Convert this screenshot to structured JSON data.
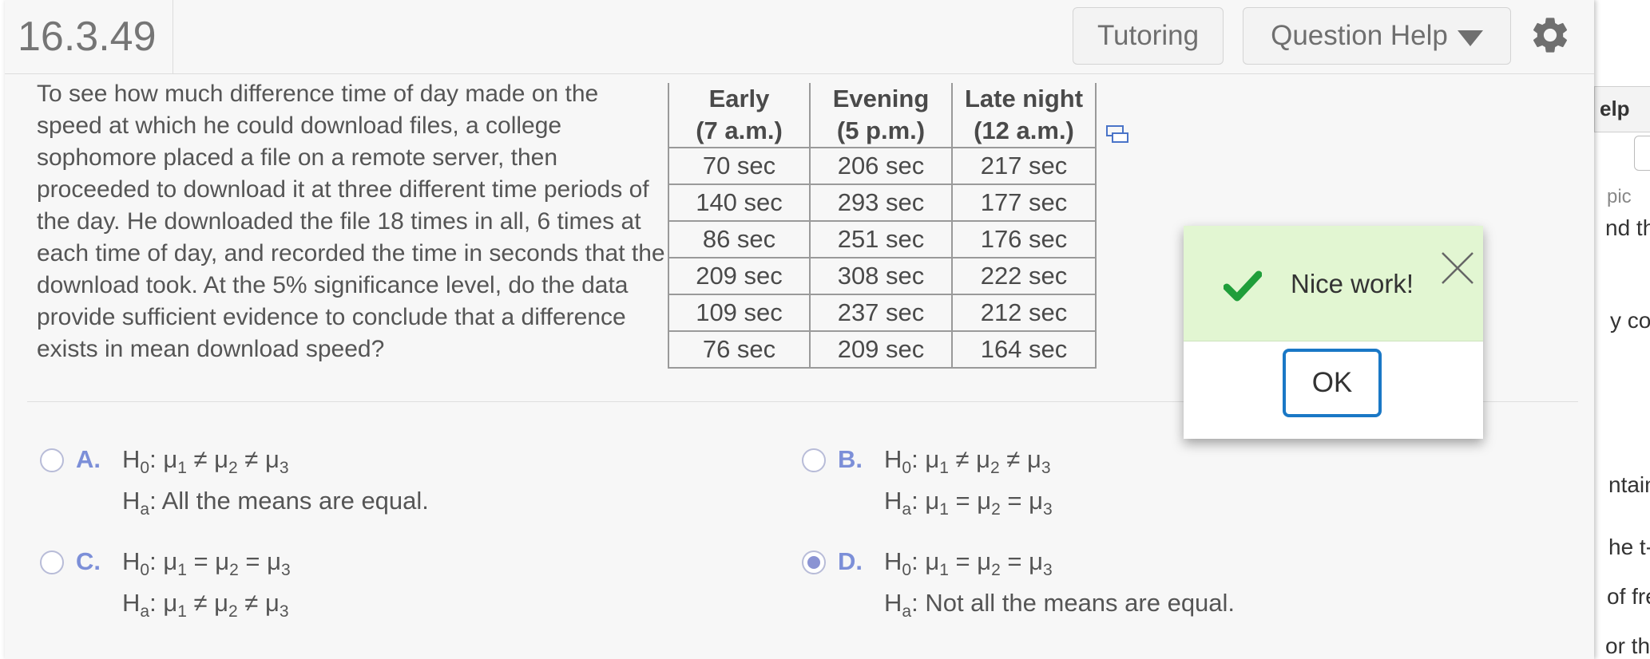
{
  "background_window": {
    "tab_label": "elp",
    "fragments": [
      "pic",
      "nd the",
      "y cor",
      "ntaini",
      "he t-s",
      "of free",
      "or the"
    ]
  },
  "header": {
    "question_number": "16.3.49",
    "tutoring_label": "Tutoring",
    "question_help_label": "Question Help",
    "settings_icon": "gear-icon"
  },
  "question": {
    "text": "To see how much difference time of day made on the speed at which he could download files, a college sophomore placed a file on a remote server, then proceeded to download it at three different time periods of the day. He downloaded the file 18 times in all, 6 times at each time of day, and recorded the time in seconds that the download took. At the 5% significance level, do the data provide sufficient evidence to conclude that a difference exists in mean download speed?"
  },
  "table": {
    "headers": [
      {
        "line1": "Early",
        "line2": "(7 a.m.)"
      },
      {
        "line1": "Evening",
        "line2": "(5 p.m.)"
      },
      {
        "line1": "Late night",
        "line2": "(12 a.m.)"
      }
    ],
    "rows": [
      [
        "70 sec",
        "206 sec",
        "217 sec"
      ],
      [
        "140 sec",
        "293 sec",
        "177 sec"
      ],
      [
        "86 sec",
        "251 sec",
        "176 sec"
      ],
      [
        "209 sec",
        "308 sec",
        "222 sec"
      ],
      [
        "109 sec",
        "237 sec",
        "212 sec"
      ],
      [
        "76 sec",
        "209 sec",
        "164 sec"
      ]
    ]
  },
  "options": {
    "a": {
      "letter": "A.",
      "h0": "μ1 ≠ μ2 ≠ μ3",
      "ha": "All the means are equal.",
      "selected": false
    },
    "b": {
      "letter": "B.",
      "h0": "μ1 ≠ μ2 ≠ μ3",
      "ha": "μ1 = μ2 = μ3",
      "selected": false
    },
    "c": {
      "letter": "C.",
      "h0": "μ1 = μ2 = μ3",
      "ha": "μ1 ≠ μ2 ≠ μ3",
      "selected": false
    },
    "d": {
      "letter": "D.",
      "h0": "μ1 = μ2 = μ3",
      "ha": "Not all the means are equal.",
      "selected": true
    }
  },
  "popup": {
    "message": "Nice work!",
    "ok_label": "OK"
  },
  "colors": {
    "accent_blue": "#1a78c6",
    "success_bg": "#e2f6d2",
    "check_green": "#1f9e3a",
    "option_letter": "#7c8fd8"
  }
}
